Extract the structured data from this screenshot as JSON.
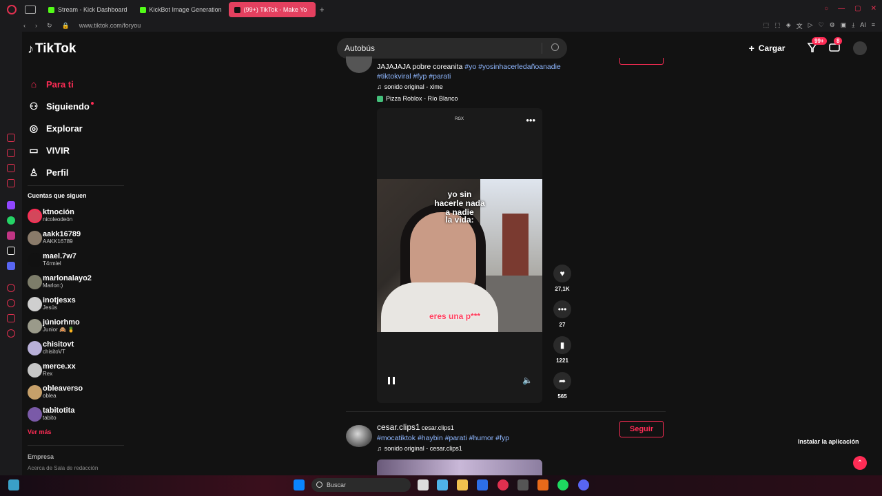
{
  "browser": {
    "tabs": [
      {
        "label": "Stream - Kick Dashboard",
        "color": "#53fc18"
      },
      {
        "label": "KickBot Image Generation",
        "color": "#53fc18"
      },
      {
        "label": "(99+) TikTok - Make Yo",
        "color": "#ffffff",
        "active": true
      }
    ],
    "new_tab": "+",
    "url": "www.tiktok.com/foryou"
  },
  "header": {
    "logo": "TikTok",
    "search_value": "Autobús",
    "upload_label": "Cargar",
    "inbox_badge": "99+",
    "messages_badge": "8"
  },
  "sidebar": {
    "nav": [
      {
        "label": "Para ti",
        "icon": "home-icon",
        "active": true
      },
      {
        "label": "Siguiendo",
        "icon": "following-icon"
      },
      {
        "label": "Explorar",
        "icon": "compass-icon"
      },
      {
        "label": "VIVIR",
        "icon": "live-icon"
      },
      {
        "label": "Perfil",
        "icon": "profile-icon"
      }
    ],
    "following_title": "Cuentas que siguen",
    "accounts": [
      {
        "user": "ktnoción",
        "name": "nicoleodeón",
        "color": "#d3475b"
      },
      {
        "user": "aakk16789",
        "name": "AAKK16789",
        "color": "#8a7b6a"
      },
      {
        "user": "mael.7w7",
        "name": "T4rmiel",
        "color": "#111111"
      },
      {
        "user": "marlonalayo2",
        "name": "Marlon:)",
        "color": "#7d7d6a"
      },
      {
        "user": "inotjesxs",
        "name": "Jesús",
        "color": "#cfcfcf"
      },
      {
        "user": "júniorhmo",
        "name": "Junior 🙈 🍍",
        "color": "#9a9a8a"
      },
      {
        "user": "chisitovt",
        "name": "chisitoVT",
        "color": "#b8b0d8"
      },
      {
        "user": "merce.xx",
        "name": "Rex",
        "color": "#c6c6c6"
      },
      {
        "user": "obleaverso",
        "name": "oblea",
        "color": "#c6a06a"
      },
      {
        "user": "tabitotita",
        "name": "tabito",
        "color": "#7a5aa8"
      }
    ],
    "see_more": "Ver más",
    "company": "Empresa",
    "company_links": "Acerca de  Sala de redacción"
  },
  "post1": {
    "caption_text": "JAJAJAJA pobre coreanita",
    "hashtags_line1": "#yo #yosinhacerledañoanadie",
    "hashtags_line2": "#tiktokviral #fyp #parati",
    "music": "sonido original - xime",
    "location": "Pizza Roblox - Río Blanco",
    "video_watermark": "RGX",
    "overlay_top": "yo sin hacerle nada a nadie",
    "overlay_mid": "la vida:",
    "overlay_bottom": "eres una p***",
    "likes": "27,1K",
    "comments": "27",
    "saves": "1221",
    "shares": "565"
  },
  "post2": {
    "user": "cesar.clips1",
    "name": "cesar.clips1",
    "hashtags": "#mocatiktok #haybin #parati #humor #fyp",
    "music": "sonido original - cesar.clips1",
    "follow_label": "Seguir"
  },
  "install_label": "Instalar la aplicación",
  "taskbar": {
    "search_placeholder": "Buscar"
  }
}
